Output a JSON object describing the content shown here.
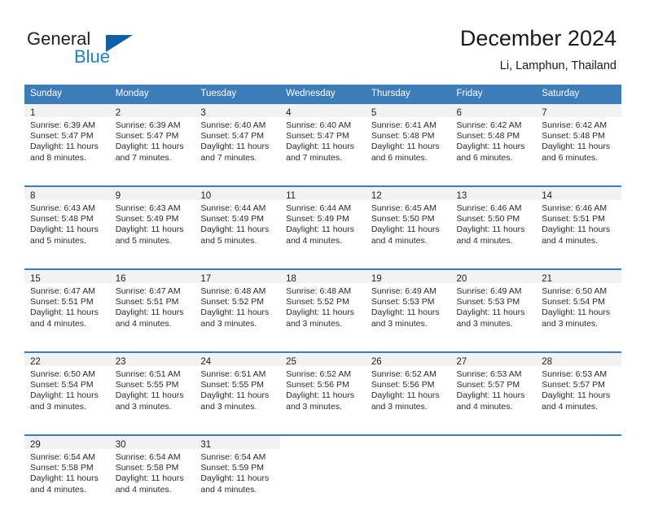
{
  "brand": {
    "name_part1": "General",
    "name_part2": "Blue",
    "colors": {
      "dark": "#231f20",
      "blue": "#1f7fc4",
      "mark": "#1060a8"
    }
  },
  "header": {
    "title": "December 2024",
    "subtitle": "Li, Lamphun, Thailand"
  },
  "calendar": {
    "accent_color": "#3b7cb9",
    "daynum_bg": "#f2f2f2",
    "weekdays": [
      "Sunday",
      "Monday",
      "Tuesday",
      "Wednesday",
      "Thursday",
      "Friday",
      "Saturday"
    ],
    "weeks": [
      [
        {
          "day": "1",
          "sunrise": "Sunrise: 6:39 AM",
          "sunset": "Sunset: 5:47 PM",
          "daylight_l1": "Daylight: 11 hours",
          "daylight_l2": "and 8 minutes."
        },
        {
          "day": "2",
          "sunrise": "Sunrise: 6:39 AM",
          "sunset": "Sunset: 5:47 PM",
          "daylight_l1": "Daylight: 11 hours",
          "daylight_l2": "and 7 minutes."
        },
        {
          "day": "3",
          "sunrise": "Sunrise: 6:40 AM",
          "sunset": "Sunset: 5:47 PM",
          "daylight_l1": "Daylight: 11 hours",
          "daylight_l2": "and 7 minutes."
        },
        {
          "day": "4",
          "sunrise": "Sunrise: 6:40 AM",
          "sunset": "Sunset: 5:47 PM",
          "daylight_l1": "Daylight: 11 hours",
          "daylight_l2": "and 7 minutes."
        },
        {
          "day": "5",
          "sunrise": "Sunrise: 6:41 AM",
          "sunset": "Sunset: 5:48 PM",
          "daylight_l1": "Daylight: 11 hours",
          "daylight_l2": "and 6 minutes."
        },
        {
          "day": "6",
          "sunrise": "Sunrise: 6:42 AM",
          "sunset": "Sunset: 5:48 PM",
          "daylight_l1": "Daylight: 11 hours",
          "daylight_l2": "and 6 minutes."
        },
        {
          "day": "7",
          "sunrise": "Sunrise: 6:42 AM",
          "sunset": "Sunset: 5:48 PM",
          "daylight_l1": "Daylight: 11 hours",
          "daylight_l2": "and 6 minutes."
        }
      ],
      [
        {
          "day": "8",
          "sunrise": "Sunrise: 6:43 AM",
          "sunset": "Sunset: 5:48 PM",
          "daylight_l1": "Daylight: 11 hours",
          "daylight_l2": "and 5 minutes."
        },
        {
          "day": "9",
          "sunrise": "Sunrise: 6:43 AM",
          "sunset": "Sunset: 5:49 PM",
          "daylight_l1": "Daylight: 11 hours",
          "daylight_l2": "and 5 minutes."
        },
        {
          "day": "10",
          "sunrise": "Sunrise: 6:44 AM",
          "sunset": "Sunset: 5:49 PM",
          "daylight_l1": "Daylight: 11 hours",
          "daylight_l2": "and 5 minutes."
        },
        {
          "day": "11",
          "sunrise": "Sunrise: 6:44 AM",
          "sunset": "Sunset: 5:49 PM",
          "daylight_l1": "Daylight: 11 hours",
          "daylight_l2": "and 4 minutes."
        },
        {
          "day": "12",
          "sunrise": "Sunrise: 6:45 AM",
          "sunset": "Sunset: 5:50 PM",
          "daylight_l1": "Daylight: 11 hours",
          "daylight_l2": "and 4 minutes."
        },
        {
          "day": "13",
          "sunrise": "Sunrise: 6:46 AM",
          "sunset": "Sunset: 5:50 PM",
          "daylight_l1": "Daylight: 11 hours",
          "daylight_l2": "and 4 minutes."
        },
        {
          "day": "14",
          "sunrise": "Sunrise: 6:46 AM",
          "sunset": "Sunset: 5:51 PM",
          "daylight_l1": "Daylight: 11 hours",
          "daylight_l2": "and 4 minutes."
        }
      ],
      [
        {
          "day": "15",
          "sunrise": "Sunrise: 6:47 AM",
          "sunset": "Sunset: 5:51 PM",
          "daylight_l1": "Daylight: 11 hours",
          "daylight_l2": "and 4 minutes."
        },
        {
          "day": "16",
          "sunrise": "Sunrise: 6:47 AM",
          "sunset": "Sunset: 5:51 PM",
          "daylight_l1": "Daylight: 11 hours",
          "daylight_l2": "and 4 minutes."
        },
        {
          "day": "17",
          "sunrise": "Sunrise: 6:48 AM",
          "sunset": "Sunset: 5:52 PM",
          "daylight_l1": "Daylight: 11 hours",
          "daylight_l2": "and 3 minutes."
        },
        {
          "day": "18",
          "sunrise": "Sunrise: 6:48 AM",
          "sunset": "Sunset: 5:52 PM",
          "daylight_l1": "Daylight: 11 hours",
          "daylight_l2": "and 3 minutes."
        },
        {
          "day": "19",
          "sunrise": "Sunrise: 6:49 AM",
          "sunset": "Sunset: 5:53 PM",
          "daylight_l1": "Daylight: 11 hours",
          "daylight_l2": "and 3 minutes."
        },
        {
          "day": "20",
          "sunrise": "Sunrise: 6:49 AM",
          "sunset": "Sunset: 5:53 PM",
          "daylight_l1": "Daylight: 11 hours",
          "daylight_l2": "and 3 minutes."
        },
        {
          "day": "21",
          "sunrise": "Sunrise: 6:50 AM",
          "sunset": "Sunset: 5:54 PM",
          "daylight_l1": "Daylight: 11 hours",
          "daylight_l2": "and 3 minutes."
        }
      ],
      [
        {
          "day": "22",
          "sunrise": "Sunrise: 6:50 AM",
          "sunset": "Sunset: 5:54 PM",
          "daylight_l1": "Daylight: 11 hours",
          "daylight_l2": "and 3 minutes."
        },
        {
          "day": "23",
          "sunrise": "Sunrise: 6:51 AM",
          "sunset": "Sunset: 5:55 PM",
          "daylight_l1": "Daylight: 11 hours",
          "daylight_l2": "and 3 minutes."
        },
        {
          "day": "24",
          "sunrise": "Sunrise: 6:51 AM",
          "sunset": "Sunset: 5:55 PM",
          "daylight_l1": "Daylight: 11 hours",
          "daylight_l2": "and 3 minutes."
        },
        {
          "day": "25",
          "sunrise": "Sunrise: 6:52 AM",
          "sunset": "Sunset: 5:56 PM",
          "daylight_l1": "Daylight: 11 hours",
          "daylight_l2": "and 3 minutes."
        },
        {
          "day": "26",
          "sunrise": "Sunrise: 6:52 AM",
          "sunset": "Sunset: 5:56 PM",
          "daylight_l1": "Daylight: 11 hours",
          "daylight_l2": "and 3 minutes."
        },
        {
          "day": "27",
          "sunrise": "Sunrise: 6:53 AM",
          "sunset": "Sunset: 5:57 PM",
          "daylight_l1": "Daylight: 11 hours",
          "daylight_l2": "and 4 minutes."
        },
        {
          "day": "28",
          "sunrise": "Sunrise: 6:53 AM",
          "sunset": "Sunset: 5:57 PM",
          "daylight_l1": "Daylight: 11 hours",
          "daylight_l2": "and 4 minutes."
        }
      ],
      [
        {
          "day": "29",
          "sunrise": "Sunrise: 6:54 AM",
          "sunset": "Sunset: 5:58 PM",
          "daylight_l1": "Daylight: 11 hours",
          "daylight_l2": "and 4 minutes."
        },
        {
          "day": "30",
          "sunrise": "Sunrise: 6:54 AM",
          "sunset": "Sunset: 5:58 PM",
          "daylight_l1": "Daylight: 11 hours",
          "daylight_l2": "and 4 minutes."
        },
        {
          "day": "31",
          "sunrise": "Sunrise: 6:54 AM",
          "sunset": "Sunset: 5:59 PM",
          "daylight_l1": "Daylight: 11 hours",
          "daylight_l2": "and 4 minutes."
        },
        {
          "day": "",
          "sunrise": "",
          "sunset": "",
          "daylight_l1": "",
          "daylight_l2": ""
        },
        {
          "day": "",
          "sunrise": "",
          "sunset": "",
          "daylight_l1": "",
          "daylight_l2": ""
        },
        {
          "day": "",
          "sunrise": "",
          "sunset": "",
          "daylight_l1": "",
          "daylight_l2": ""
        },
        {
          "day": "",
          "sunrise": "",
          "sunset": "",
          "daylight_l1": "",
          "daylight_l2": ""
        }
      ]
    ]
  }
}
